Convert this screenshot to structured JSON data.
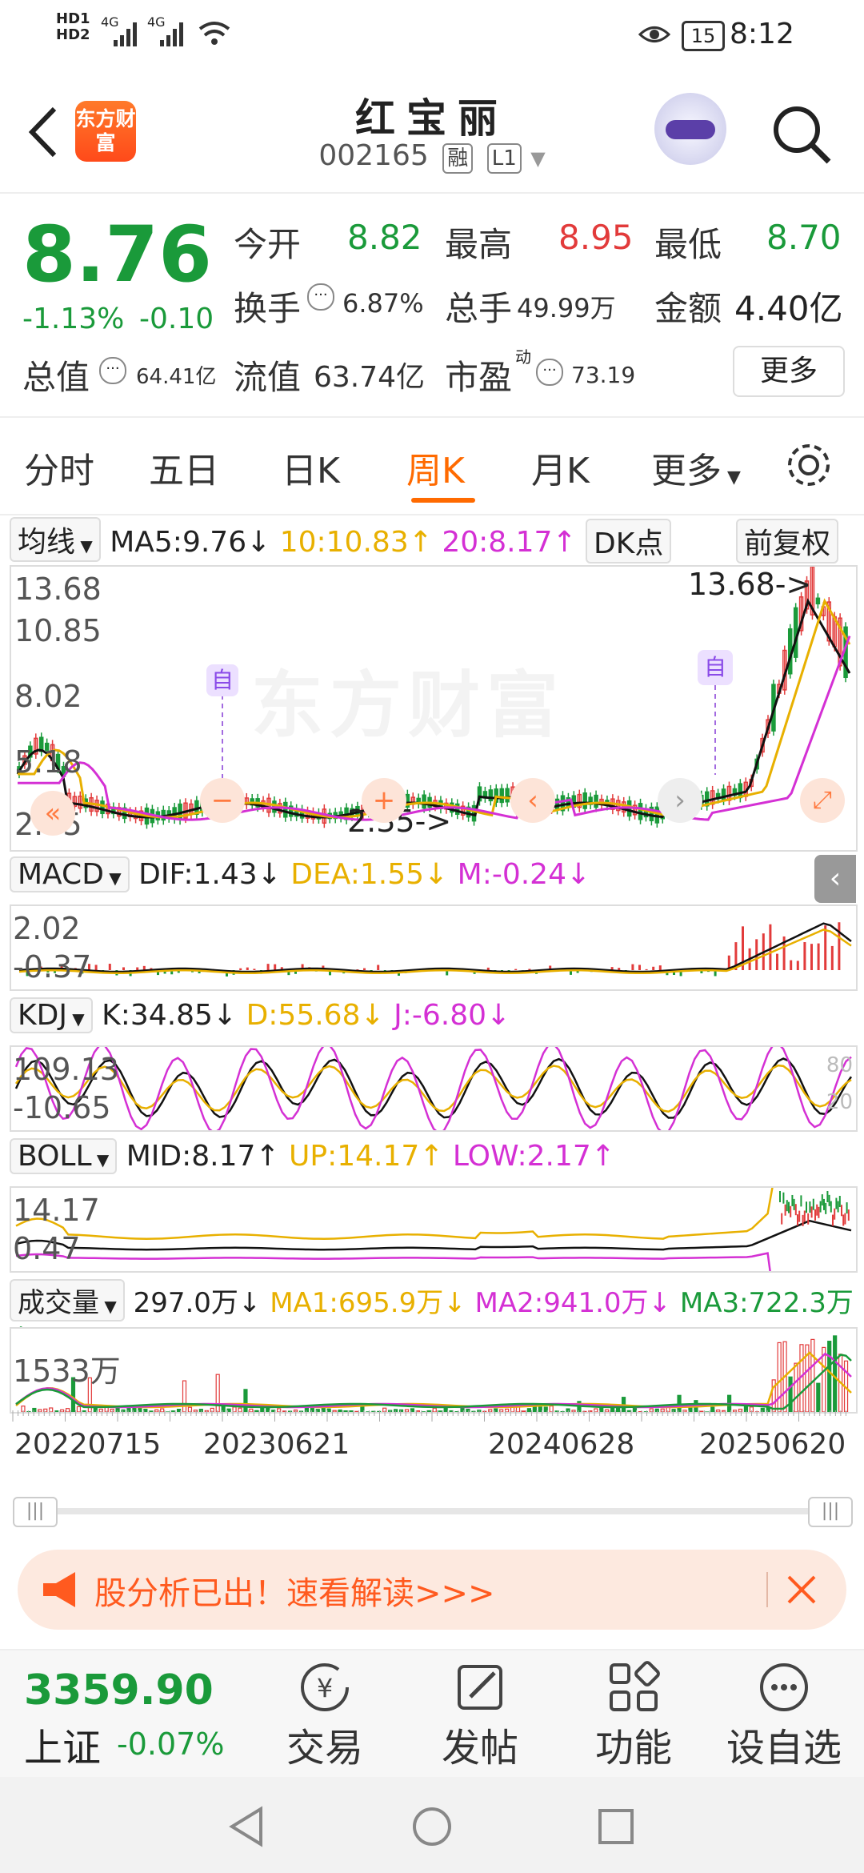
{
  "status_bar": {
    "network_hd1": "HD1",
    "network_hd2": "HD2",
    "sig1": "4G",
    "sig2": "4G",
    "battery": "15",
    "time": "8:12"
  },
  "header": {
    "brand": "东方财富",
    "name": "红宝丽",
    "code": "002165",
    "tag1": "融",
    "tag2": "L1"
  },
  "quote": {
    "price": "8.76",
    "change_pct": "-1.13%",
    "change": "-0.10",
    "open_label": "今开",
    "open": "8.82",
    "high_label": "最高",
    "high": "8.95",
    "low_label": "最低",
    "low": "8.70",
    "turnover_label": "换手",
    "turnover": "6.87%",
    "volume_label": "总手",
    "volume": "49.99万",
    "amount_label": "金额",
    "amount": "4.40亿",
    "mktcap_label": "总值",
    "mktcap": "64.41亿",
    "float_label": "流值",
    "float_cap": "63.74亿",
    "pe_label": "市盈",
    "pe_sup": "动",
    "pe": "73.19",
    "more": "更多"
  },
  "tabs": [
    "分时",
    "五日",
    "日K",
    "周K",
    "月K",
    "更多"
  ],
  "active_tab": "周K",
  "ma_bar": {
    "selector": "均线",
    "ma5": "MA5:9.76↓",
    "ma10": "10:10.83↑",
    "ma20": "20:8.17↑",
    "dk": "DK点",
    "adjust": "前复权"
  },
  "kline": {
    "y_labels": [
      "13.68",
      "10.85",
      "8.02",
      "5.18",
      "2.35"
    ],
    "high_mark": "13.68->",
    "low_mark": "2.35->",
    "watermark": "东方财富",
    "self_tag": "自"
  },
  "macd": {
    "selector": "MACD",
    "dif": "DIF:1.43↓",
    "dea": "DEA:1.55↓",
    "m": "M:-0.24↓",
    "y_top": "2.02",
    "y_bot": "-0.37"
  },
  "kdj": {
    "selector": "KDJ",
    "k": "K:34.85↓",
    "d": "D:55.68↓",
    "j": "J:-6.80↓",
    "y_top": "109.13",
    "y_bot": "-10.65",
    "r_top": "80",
    "r_bot": "20"
  },
  "boll": {
    "selector": "BOLL",
    "mid": "MID:8.17↑",
    "up": "UP:14.17↑",
    "low": "LOW:2.17↑",
    "y_top": "14.17",
    "y_bot": "0.47"
  },
  "vol": {
    "selector": "成交量",
    "cur": "297.0万↓",
    "ma1": "MA1:695.9万↓",
    "ma2": "MA2:941.0万↓",
    "ma3": "MA3:722.3万↑",
    "y_top": "1533万"
  },
  "x_dates": [
    "20220715",
    "20230621",
    "20240628",
    "20250620"
  ],
  "banner": {
    "text": "股分析已出！速看解读>>>"
  },
  "bottom": {
    "index_value": "3359.90",
    "index_name": "上证",
    "index_change": "-0.07%",
    "trade": "交易",
    "post": "发帖",
    "func": "功能",
    "watch": "设自选"
  },
  "colors": {
    "up": "#e23b3b",
    "down": "#1a9a3a",
    "accent": "#ff6a00",
    "ma10": "#e8b000",
    "ma20": "#d430d4"
  }
}
